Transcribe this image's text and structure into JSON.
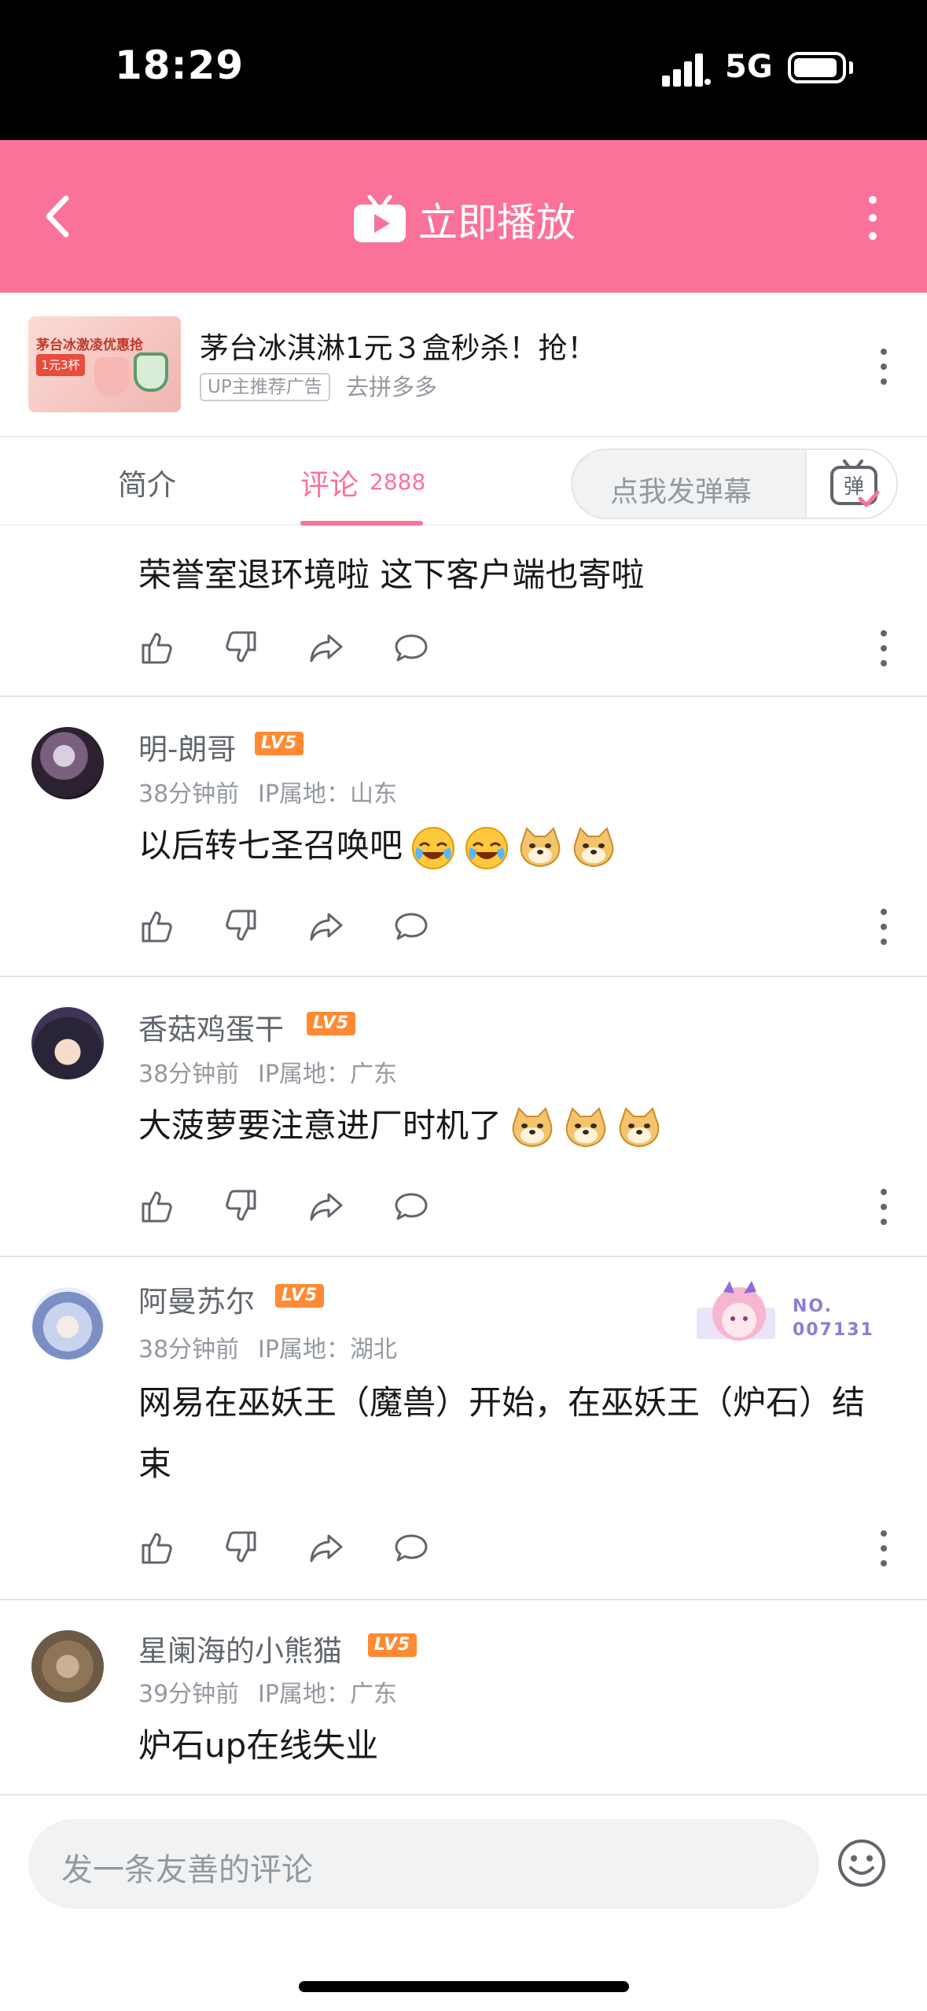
{
  "status_bar": {
    "time": "18:29",
    "network": "5G"
  },
  "header": {
    "play_label": "立即播放"
  },
  "ad": {
    "title": "茅台冰淇淋1元３盒秒杀！抢！",
    "badge": "UP主推荐广告",
    "source": "去拼多多",
    "thumb_title": "茅台冰激凌优惠抢",
    "thumb_tag": "1元3杯"
  },
  "tabs": {
    "intro": "简介",
    "comments": "评论",
    "comments_count": "2888",
    "danmaku_placeholder": "点我发弹幕",
    "danmaku_icon_text": "弹"
  },
  "comments": [
    {
      "content": "荣誉室退环境啦 这下客户端也寄啦"
    },
    {
      "user": "明-朗哥",
      "level": "LV5",
      "time": "38分钟前",
      "ip": "IP属地：山东",
      "content": "以后转七圣召唤吧",
      "emojis": [
        "laugh-cry-emoji",
        "laugh-cry-emoji",
        "doge-emoji",
        "doge-emoji"
      ]
    },
    {
      "user": "香菇鸡蛋干",
      "level": "LV5",
      "time": "38分钟前",
      "ip": "IP属地：广东",
      "content": "大菠萝要注意进厂时机了",
      "emojis": [
        "doge-emoji",
        "doge-emoji",
        "doge-emoji"
      ]
    },
    {
      "user": "阿曼苏尔",
      "level": "LV5",
      "time": "38分钟前",
      "ip": "IP属地：湖北",
      "content": "网易在巫妖王（魔兽）开始，在巫妖王（炉石）结束",
      "medal_label": "NO.",
      "medal_number": "007131"
    },
    {
      "user": "星阑海的小熊猫",
      "level": "LV5",
      "time": "39分钟前",
      "ip": "IP属地：广东",
      "content": "炉石up在线失业"
    }
  ],
  "bottom": {
    "placeholder": "发一条友善的评论"
  },
  "colors": {
    "brand_pink": "#fb7299",
    "level_orange": "#ff8a33",
    "text_primary": "#18191c",
    "text_secondary": "#9499a0"
  }
}
